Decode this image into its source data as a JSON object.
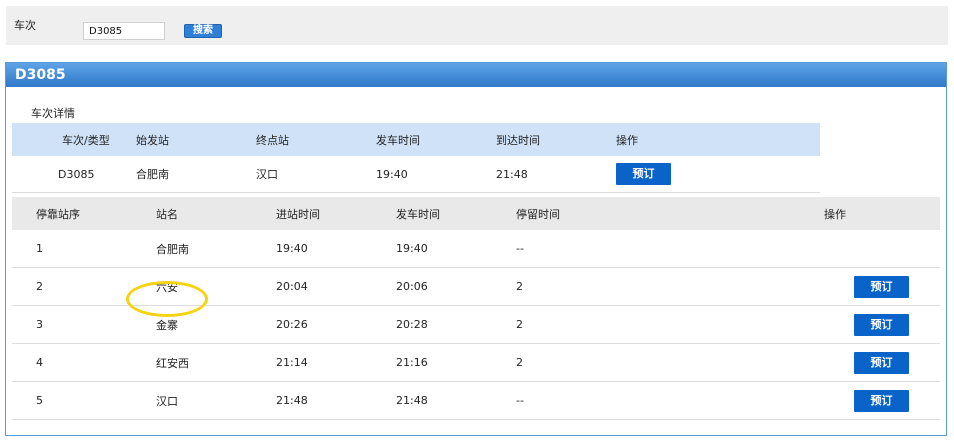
{
  "search": {
    "label": "车次",
    "value": "D3085",
    "button": "搜索"
  },
  "panel": {
    "title": "D3085",
    "section_title": "车次详情"
  },
  "detail": {
    "headers": [
      "车次/类型",
      "始发站",
      "终点站",
      "发车时间",
      "到达时间",
      "操作"
    ],
    "row": {
      "train": "D3085",
      "from": "合肥南",
      "to": "汉口",
      "depart": "19:40",
      "arrive": "21:48",
      "action": "预订"
    }
  },
  "stops": {
    "headers": [
      "停靠站序",
      "站名",
      "进站时间",
      "发车时间",
      "停留时间",
      "操作"
    ],
    "rows": [
      {
        "seq": "1",
        "station": "合肥南",
        "arrive": "19:40",
        "depart": "19:40",
        "stay": "--",
        "action": ""
      },
      {
        "seq": "2",
        "station": "六安",
        "arrive": "20:04",
        "depart": "20:06",
        "stay": "2",
        "action": "预订"
      },
      {
        "seq": "3",
        "station": "金寨",
        "arrive": "20:26",
        "depart": "20:28",
        "stay": "2",
        "action": "预订"
      },
      {
        "seq": "4",
        "station": "红安西",
        "arrive": "21:14",
        "depart": "21:16",
        "stay": "2",
        "action": "预订"
      },
      {
        "seq": "5",
        "station": "汉口",
        "arrive": "21:48",
        "depart": "21:48",
        "stay": "--",
        "action": "预订"
      }
    ]
  },
  "colors": {
    "accent": "#0a63c9",
    "panel_header": "#2f79c9",
    "highlight_circle": "#f5d311",
    "detail_header_bg": "#cfe2f7"
  }
}
